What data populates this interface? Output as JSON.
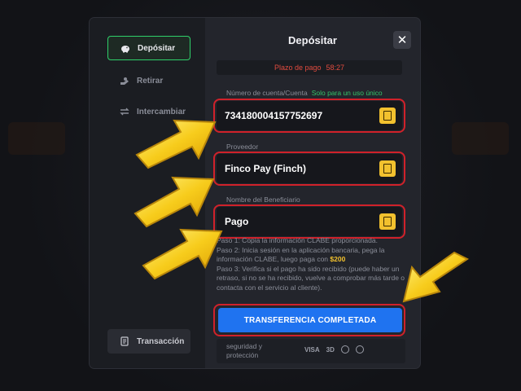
{
  "sidebar": {
    "items": [
      {
        "label": "Depósitar",
        "icon": "piggy-bank-icon"
      },
      {
        "label": "Retirar",
        "icon": "hand-withdraw-icon"
      },
      {
        "label": "Intercambiar",
        "icon": "exchange-arrows-icon"
      }
    ],
    "transactions": {
      "label": "Transacción",
      "icon": "receipt-icon"
    }
  },
  "modal": {
    "title": "Depósitar",
    "close_icon": "close-icon"
  },
  "deadline": {
    "label": "Plazo de pago",
    "time": "58:27"
  },
  "fields": {
    "account": {
      "label": "Número de cuenta/Cuenta",
      "note": "Solo para un uso único",
      "value": "734180004157752697"
    },
    "provider": {
      "label": "Proveedor",
      "value": "Finco Pay (Finch)"
    },
    "beneficiary": {
      "label": "Nombre del Beneficiario",
      "value": "Pago"
    }
  },
  "steps": {
    "step1": "Paso 1: Copia la información CLABE proporcionada.",
    "step2_a": "Paso 2: Inicia sesión en la aplicación bancaria, pega la información CLABE, luego paga con",
    "step2_amount": "$200",
    "step3": "Paso 3: Verifica si el pago ha sido recibido (puede haber un retraso, si no se ha recibido, vuelve a comprobar más tarde o contacta con el servicio al cliente)."
  },
  "confirm_button": "TRANSFERENCIA COMPLETADA",
  "footer": {
    "security_line1": "seguridad y",
    "security_line2": "protección",
    "badge_1": "VISA",
    "badge_2": "3D"
  },
  "colors": {
    "accent_blue": "#1f73f0",
    "accent_green": "#2fd06a",
    "copy_yellow": "#f2c12e",
    "highlight_red": "#d0212a",
    "deadline_red": "#e04b3f"
  }
}
